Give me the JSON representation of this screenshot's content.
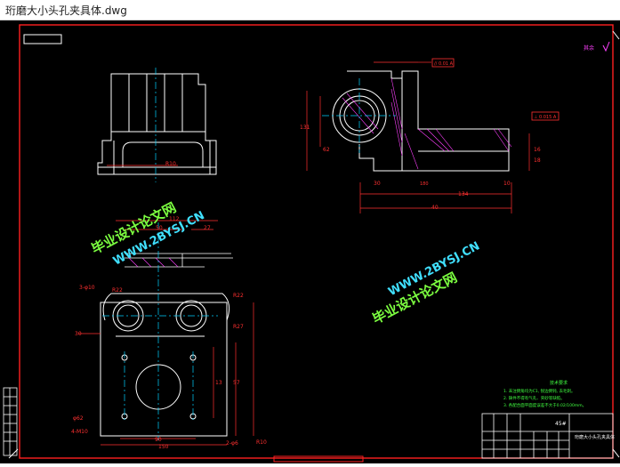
{
  "window": {
    "title": "珩磨大小头孔夹具体.dwg"
  },
  "watermarks": [
    {
      "line1": "毕业设计论文网",
      "line2": "WWW.2BYSJ.CN"
    },
    {
      "line1": "毕业设计论文网",
      "line2": "WWW.2BYSJ.CN"
    }
  ],
  "drawing": {
    "roughness_note": "其余",
    "tech_req_title": "技术要求",
    "tech_req_items": [
      "1. 未注倒角均为C1, 锐边倒钝, 去毛刺。",
      "2. 铸件不得有气孔、夹砂等缺陷。",
      "3. 各配合面平面度误差不大于0.02/100mm。"
    ],
    "title_block": {
      "material": "45#",
      "name": "珩磨大小头孔夹具体"
    },
    "dims": {
      "side_180": "180",
      "side_134": "134",
      "side_10": "10",
      "side_30": "30",
      "side_16": "16",
      "side_18": "18",
      "side_40": "40",
      "side_131": "131",
      "side_62": "62",
      "front_r10": "R10",
      "top_112": "112",
      "top_50": "50",
      "top_27": "27",
      "top_r22": "R22",
      "top_r22b": "R22",
      "top_r27": "R27",
      "top_150": "150",
      "top_90": "90",
      "top_r10": "R10",
      "top_13": "13",
      "top_57": "57",
      "top_30": "30",
      "hole_2phi6": "2-φ6",
      "hole_3phi10": "3-φ10",
      "hole_4m10": "4-M10",
      "hole_phi62": "φ62",
      "tol_a": "// 0.01 A",
      "tol_b": "⊥ 0.015 A"
    }
  }
}
